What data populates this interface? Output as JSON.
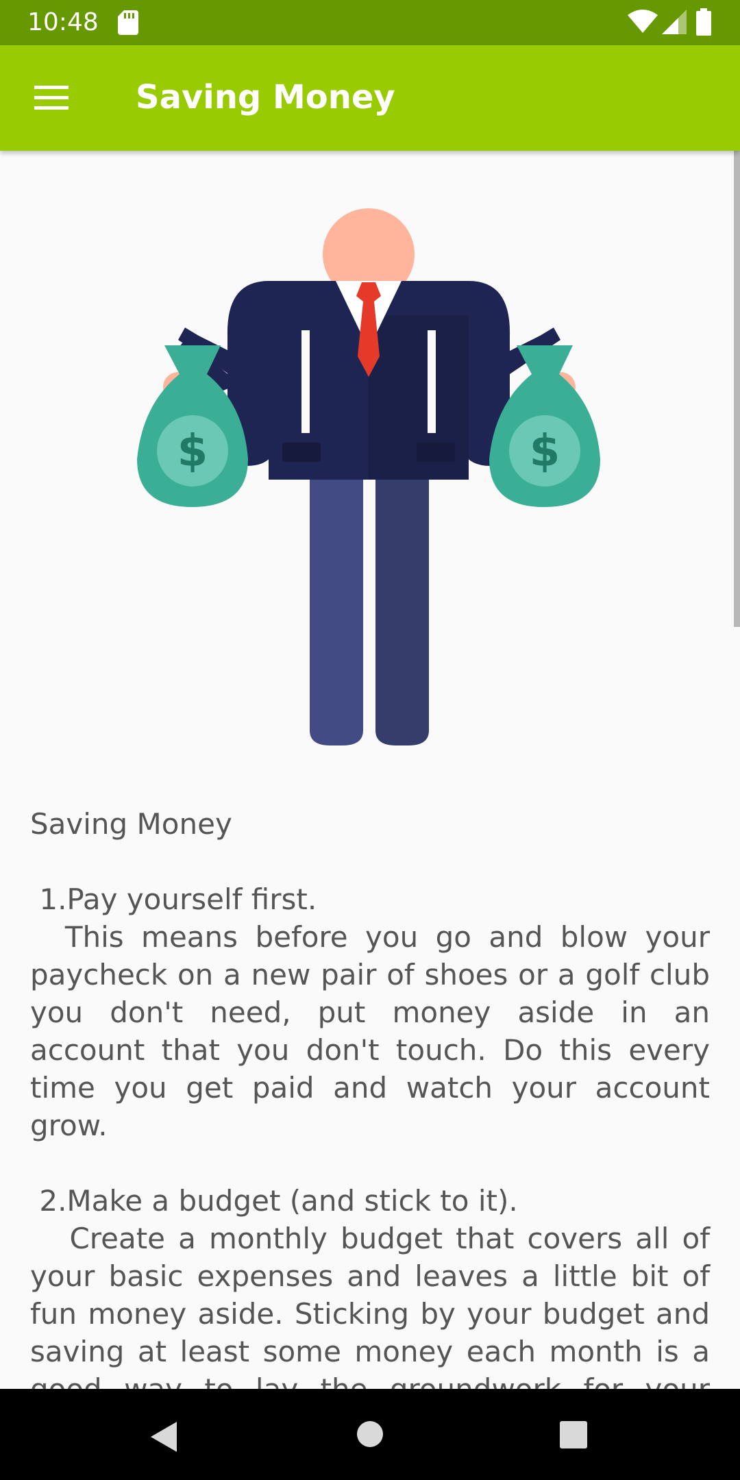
{
  "status_bar": {
    "time": "10:48",
    "icons": [
      "sd-card-icon",
      "wifi-icon",
      "signal-icon",
      "battery-icon"
    ]
  },
  "app_bar": {
    "title": "Saving Money",
    "menu_icon": "hamburger-menu-icon",
    "background": "#99cc00"
  },
  "illustration": {
    "icon": "businessman-with-money-bags-icon",
    "bag_symbol": "$"
  },
  "article": {
    "heading": "Saving Money",
    "tip1_title": " 1.Pay yourself first.",
    "tip1_body": "  This means before you go and blow your paycheck on a new pair of shoes or a golf club you don't need, put money aside in an account that you don't touch. Do this every time you get paid and watch your account grow.",
    "tip2_title": " 2.Make a budget (and stick to it).",
    "tip2_body": "   Create a monthly budget that covers all of your basic expenses and leaves a little bit of fun money aside. Sticking by your budget and saving at least some money each month is a good way to lay the groundwork for your efforts to get rich."
  },
  "nav_bar": {
    "back_icon": "back-triangle-icon",
    "home_icon": "home-circle-icon",
    "recents_icon": "recents-square-icon"
  },
  "colors": {
    "status_bar": "#669900",
    "app_bar": "#99cc00",
    "text": "#555555",
    "money_bag": "#3aaf96"
  }
}
